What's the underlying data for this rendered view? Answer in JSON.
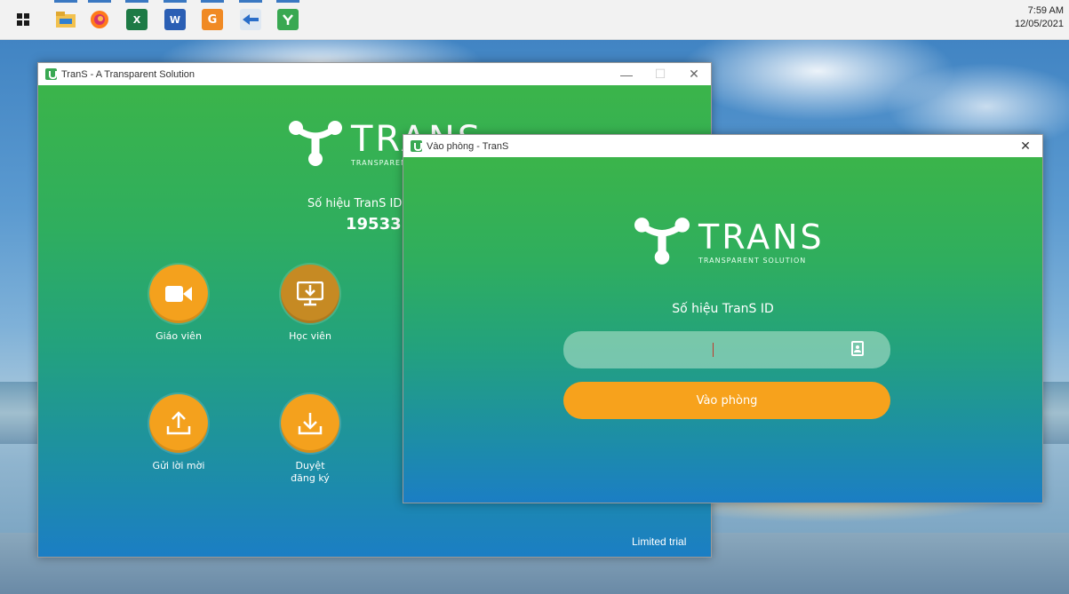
{
  "taskbar": {
    "apps": [
      {
        "name": "windows-start-icon"
      },
      {
        "name": "file-explorer-icon"
      },
      {
        "name": "firefox-icon"
      },
      {
        "name": "excel-icon"
      },
      {
        "name": "word-icon"
      },
      {
        "name": "foxit-icon"
      },
      {
        "name": "teamviewer-icon"
      },
      {
        "name": "trans-app-icon"
      }
    ],
    "time": "7:59 AM",
    "date": "12/05/2021"
  },
  "main_window": {
    "title": "TranS - A Transparent Solution",
    "logo_text": "TRANS",
    "logo_sub": "TRANSPARENT SOLUTION",
    "id_label": "Số hiệu TranS ID",
    "id_value": "19533",
    "tiles": [
      {
        "label": "Giáo viên",
        "icon": "video-camera-icon"
      },
      {
        "label": "Học viên",
        "icon": "monitor-download-icon"
      },
      {
        "label": "Gửi lời mời",
        "icon": "upload-icon"
      },
      {
        "label": "Duyệt đăng ký",
        "icon": "download-icon"
      }
    ],
    "trial_text": "Limited trial",
    "accent": "#f4a11d"
  },
  "dialog": {
    "title": "Vào phòng - TranS",
    "logo_text": "TRANS",
    "logo_sub": "TRANSPARENT SOLUTION",
    "id_label": "Số hiệu TranS ID",
    "id_input_value": "",
    "join_label": "Vào phòng",
    "accent": "#f7a21c"
  }
}
